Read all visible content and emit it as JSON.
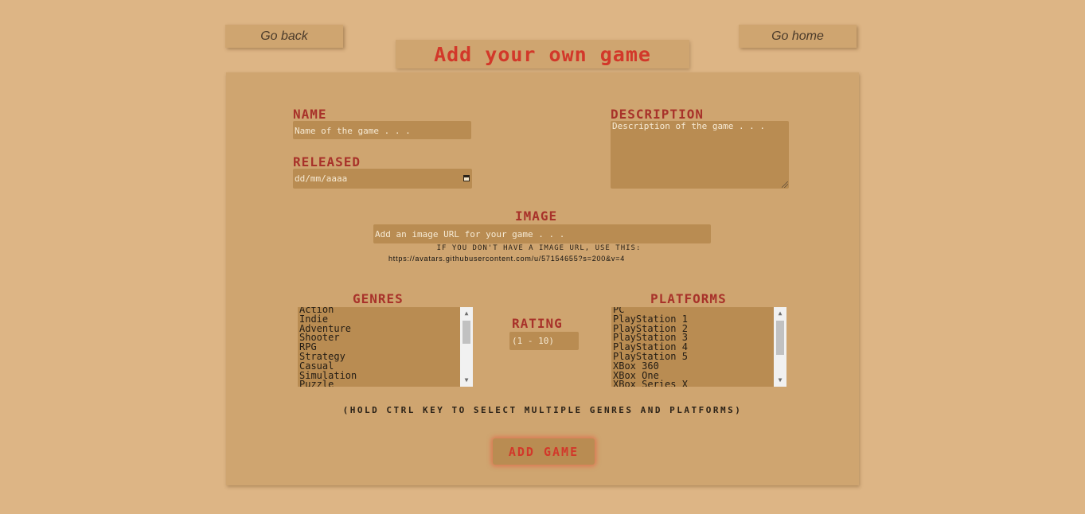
{
  "nav": {
    "back_label": "Go back",
    "home_label": "Go home"
  },
  "page": {
    "title": "Add your own game"
  },
  "form": {
    "name": {
      "label": "NAME",
      "placeholder": "Name of the game . . ."
    },
    "released": {
      "label": "RELEASED",
      "placeholder": "dd/mm/aaaa"
    },
    "description": {
      "label": "DESCRIPTION",
      "placeholder": "Description of the game . . ."
    },
    "image": {
      "label": "IMAGE",
      "placeholder": "Add an image URL for your game . . .",
      "hint": "IF YOU DON'T HAVE A IMAGE URL, USE THIS:",
      "fallback_url": "https://avatars.githubusercontent.com/u/57154655?s=200&v=4"
    },
    "genres": {
      "label": "GENRES",
      "options": [
        "Action",
        "Indie",
        "Adventure",
        "Shooter",
        "RPG",
        "Strategy",
        "Casual",
        "Simulation",
        "Puzzle"
      ]
    },
    "rating": {
      "label": "RATING",
      "placeholder": "(1 - 10)"
    },
    "platforms": {
      "label": "PLATFORMS",
      "options": [
        "PC",
        "PlayStation 1",
        "PlayStation 2",
        "PlayStation 3",
        "PlayStation 4",
        "PlayStation 5",
        "XBox 360",
        "XBox One",
        "XBox Series X"
      ]
    },
    "multi_select_hint": "(HOLD CTRL KEY TO SELECT MULTIPLE GENRES AND PLATFORMS)",
    "submit_label": "ADD GAME"
  },
  "colors": {
    "page_background": "#ddb585",
    "panel_background": "#cfa570",
    "field_background": "#b98c52",
    "label_color": "#a8322a",
    "accent_red": "#d2382a"
  }
}
